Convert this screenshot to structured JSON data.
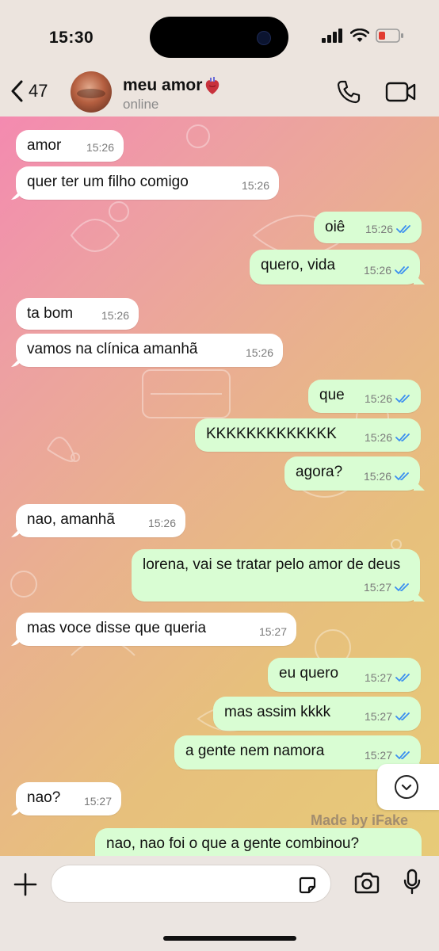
{
  "status_bar": {
    "time": "15:30"
  },
  "header": {
    "back_count": "47",
    "contact_name": "meu amor",
    "contact_emoji": "anatomical-heart",
    "contact_status": "online"
  },
  "messages": [
    {
      "dir": "in",
      "text": "amor",
      "time": "15:26"
    },
    {
      "dir": "in",
      "text": "quer ter um filho comigo",
      "time": "15:26"
    },
    {
      "dir": "out",
      "text": "oiê",
      "time": "15:26",
      "read": true
    },
    {
      "dir": "out",
      "text": "quero, vida",
      "time": "15:26",
      "read": true
    },
    {
      "dir": "in",
      "text": "ta bom",
      "time": "15:26"
    },
    {
      "dir": "in",
      "text": "vamos na clínica amanhã",
      "time": "15:26"
    },
    {
      "dir": "out",
      "text": "que",
      "time": "15:26",
      "read": true
    },
    {
      "dir": "out",
      "text": "KKKKKKKKKKKKK",
      "time": "15:26",
      "read": true
    },
    {
      "dir": "out",
      "text": "agora?",
      "time": "15:26",
      "read": true
    },
    {
      "dir": "in",
      "text": "nao, amanhã",
      "time": "15:26"
    },
    {
      "dir": "out",
      "text": "lorena, vai se tratar pelo amor de deus",
      "time": "15:27",
      "read": true
    },
    {
      "dir": "in",
      "text": "mas voce disse que queria",
      "time": "15:27"
    },
    {
      "dir": "out",
      "text": "eu quero",
      "time": "15:27",
      "read": true
    },
    {
      "dir": "out",
      "text": "mas assim kkkk",
      "time": "15:27",
      "read": true
    },
    {
      "dir": "out",
      "text": "a gente nem namora",
      "time": "15:27",
      "read": true
    },
    {
      "dir": "in",
      "text": "nao?",
      "time": "15:27"
    },
    {
      "dir": "out",
      "text": "nao, nao foi o que a gente combinou?",
      "time": "",
      "read": false
    }
  ],
  "watermark": "Made by iFake",
  "composer": {
    "placeholder": ""
  },
  "colors": {
    "incoming_bubble": "#ffffff",
    "outgoing_bubble": "#d9fdd3",
    "read_ticks": "#3b8ff0"
  }
}
